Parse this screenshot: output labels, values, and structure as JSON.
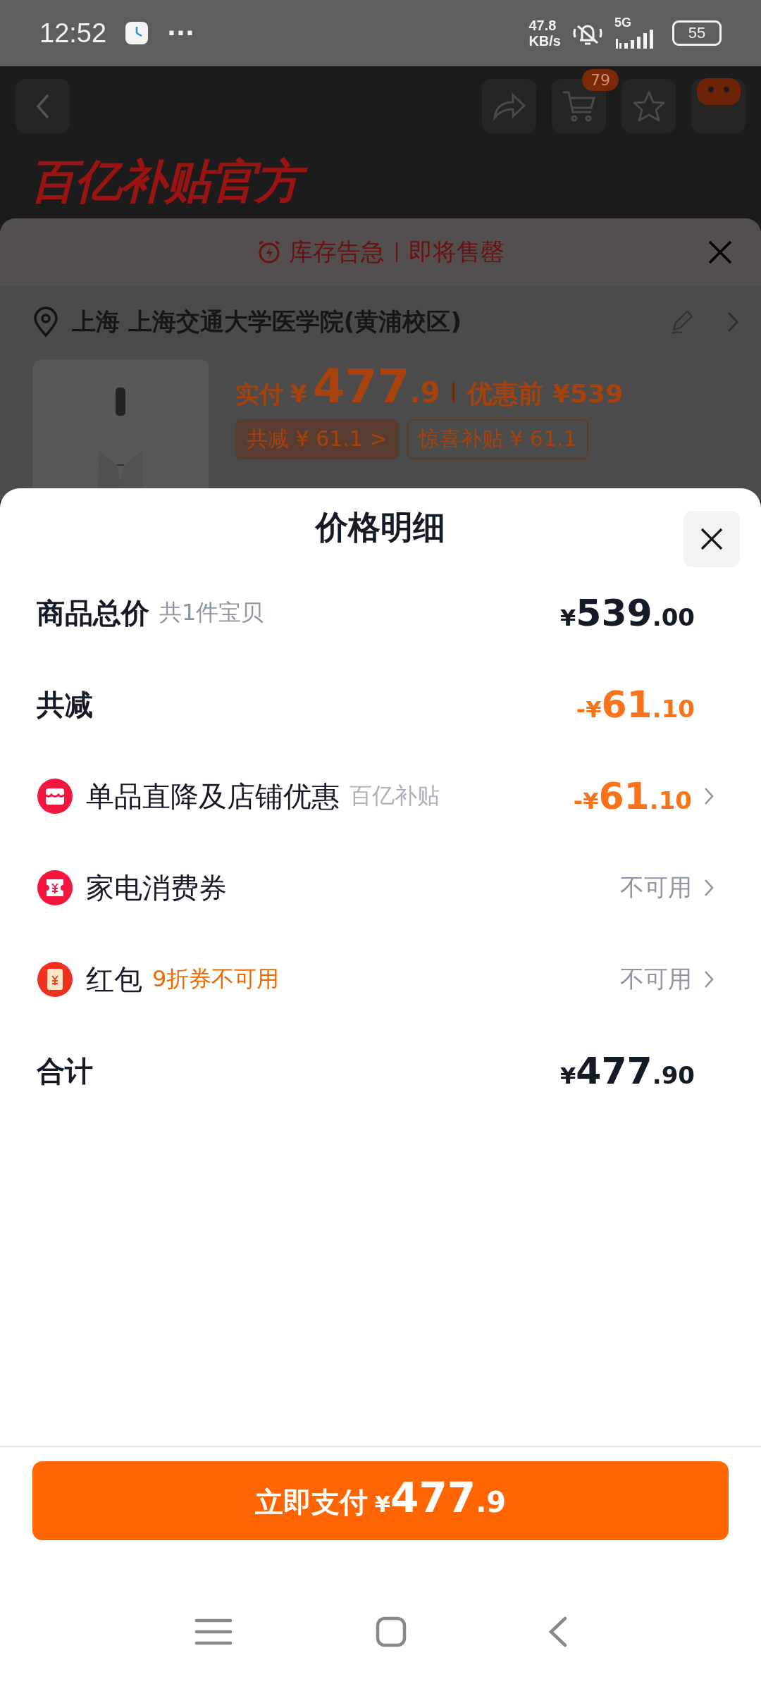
{
  "status_bar": {
    "time": "12:52",
    "more": "···",
    "speed": "47.8",
    "speed_unit": "KB/s",
    "network": "5G",
    "battery": "55"
  },
  "header": {
    "cart_badge": "79",
    "brand_title": "百亿补贴官方"
  },
  "order_sheet": {
    "alert": [
      "库存告急",
      "即将售罄"
    ],
    "address": "上海 上海交通大学医学院(黄浦校区)",
    "price": {
      "label": "实付",
      "currency": "¥",
      "main": "477",
      "minor": ".9",
      "original": "优惠前 ¥539"
    },
    "tags": [
      {
        "text": "共减 ¥ 61.1 >",
        "filled": true
      },
      {
        "text": "惊喜补贴 ¥ 61.1",
        "filled": false
      }
    ]
  },
  "price_detail": {
    "title": "价格明细",
    "rows": [
      {
        "kind": "plain",
        "label": "商品总价",
        "note": {
          "text": "共1件宝贝",
          "color": "#8a96a3"
        },
        "value": {
          "kind": "amount",
          "color": "#131b26",
          "prefix": "¥",
          "main": "539",
          "minor": ".00"
        },
        "link": false
      },
      {
        "kind": "plain",
        "label": "共减",
        "value": {
          "kind": "amount",
          "color": "#f8731a",
          "prefix": "-¥",
          "main": "61",
          "minor": ".10"
        },
        "link": false
      },
      {
        "kind": "store",
        "label": "单品直降及店铺优惠",
        "note": {
          "text": "百亿补贴",
          "color": "#a9b1ba"
        },
        "value": {
          "kind": "amount",
          "color": "#f8731a",
          "prefix": "-¥",
          "main": "61",
          "minor": ".10"
        },
        "link": true
      },
      {
        "kind": "coupon",
        "label": "家电消费券",
        "value": {
          "kind": "status",
          "text": "不可用"
        },
        "link": true
      },
      {
        "kind": "packet",
        "label": "红包",
        "note": {
          "text": "9折券不可用",
          "color": "#f06a00"
        },
        "value": {
          "kind": "status",
          "text": "不可用"
        },
        "link": true
      },
      {
        "kind": "plain",
        "label": "合计",
        "value": {
          "kind": "amount",
          "color": "#131b26",
          "prefix": "¥",
          "main": "477",
          "minor": ".90"
        },
        "link": false
      }
    ]
  },
  "pay_button": {
    "label": "立即支付",
    "currency": "¥",
    "main": "477",
    "minor": ".9"
  }
}
